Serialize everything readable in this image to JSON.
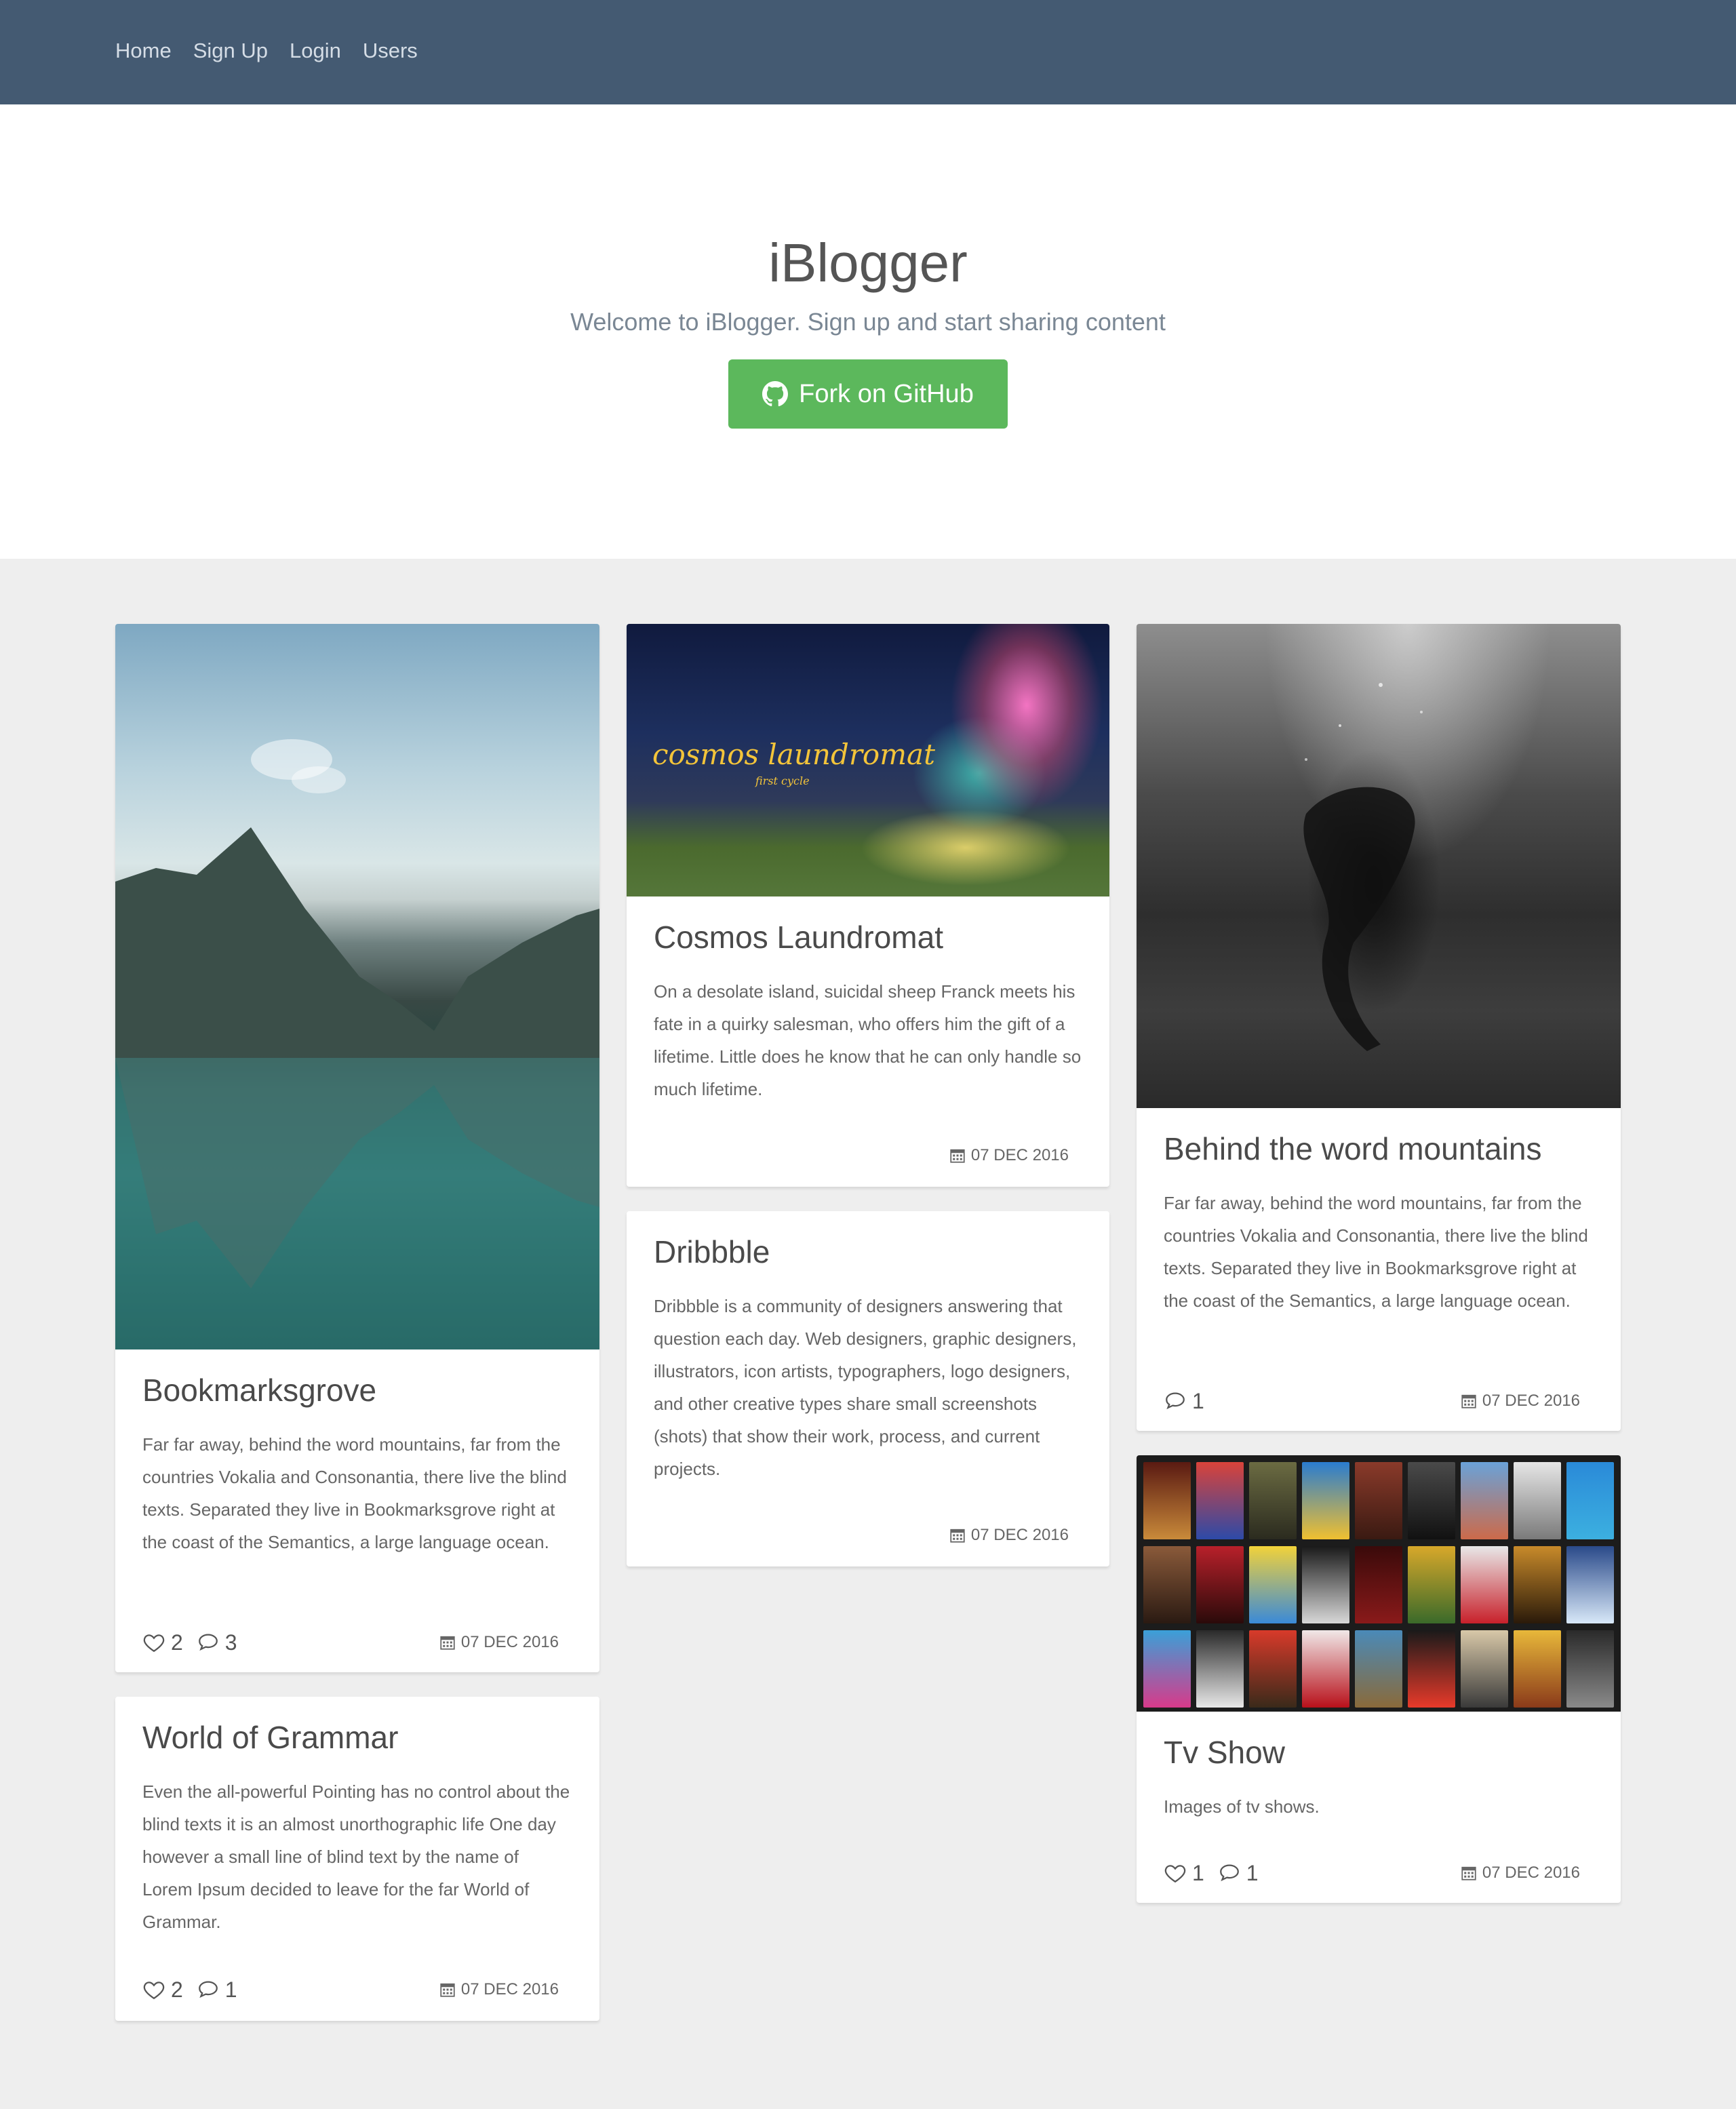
{
  "nav": {
    "items": [
      {
        "label": "Home"
      },
      {
        "label": "Sign Up"
      },
      {
        "label": "Login"
      },
      {
        "label": "Users"
      }
    ]
  },
  "hero": {
    "title": "iBlogger",
    "subtitle": "Welcome to iBlogger. Sign up and start sharing content",
    "button_label": "Fork on GitHub",
    "button_icon": "github-icon"
  },
  "colors": {
    "navbar": "#445a72",
    "accent_green": "#5cb85c",
    "page_bg": "#eeeeee"
  },
  "posts": [
    {
      "title": "Bookmarksgrove",
      "description": "Far far away, behind the word mountains, far from the countries Vokalia and Consonantia, there live the blind texts. Separated they live in Bookmarksgrove right at the coast of the Semantics, a large language ocean.",
      "likes": "2",
      "comments": "3",
      "date": "07 DEC 2016"
    },
    {
      "title": "World of Grammar",
      "description": "Even the all-powerful Pointing has no control about the blind texts it is an almost unorthographic life One day however a small line of blind text by the name of Lorem Ipsum decided to leave for the far World of Grammar.",
      "likes": "2",
      "comments": "1",
      "date": "07 DEC 2016"
    },
    {
      "title": "Cosmos Laundromat",
      "description": "On a desolate island, suicidal sheep Franck meets his fate in a quirky salesman, who offers him the gift of a lifetime. Little does he know that he can only handle so much lifetime.",
      "date": "07 DEC 2016",
      "image_text": "cosmos laundromat",
      "image_subtext": "first cycle"
    },
    {
      "title": "Dribbble",
      "description": "Dribbble is a community of designers answering that question each day. Web designers, graphic designers, illustrators, icon artists, typographers, logo designers, and other creative types share small screenshots (shots) that show their work, process, and current projects.",
      "date": "07 DEC 2016"
    },
    {
      "title": "Behind the word mountains",
      "description": "Far far away, behind the word mountains, far from the countries Vokalia and Consonantia, there live the blind texts. Separated they live in Bookmarksgrove right at the coast of the Semantics, a large language ocean.",
      "comments": "1",
      "date": "07 DEC 2016"
    },
    {
      "title": "Tv Show",
      "description": "Images of tv shows.",
      "likes": "1",
      "comments": "1",
      "date": "07 DEC 2016"
    }
  ]
}
